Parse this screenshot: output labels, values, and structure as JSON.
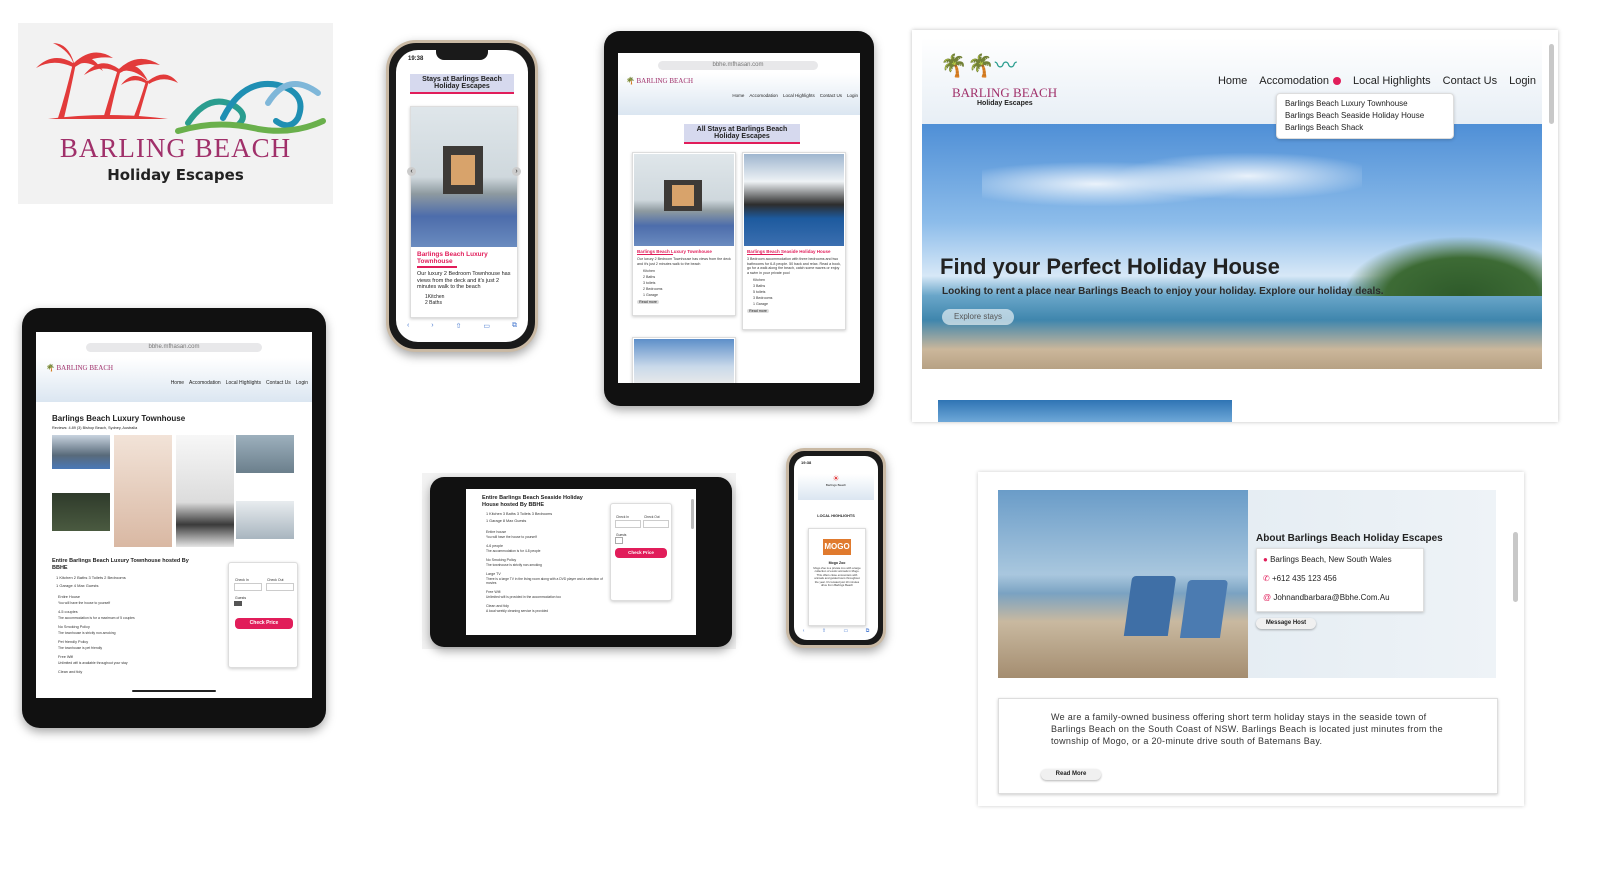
{
  "logo": {
    "brand": "BARLING BEACH",
    "tagline": "Holiday Escapes"
  },
  "colors": {
    "accent_pink": "#e11d5a",
    "palm_red": "#e23b3b",
    "wave_teal": "#2a9d8f",
    "logo_purple": "#a0306a"
  },
  "phone_top": {
    "time": "19:38",
    "heading": "Stays at Barlings Beach Holiday Escapes",
    "card_title": "Barlings Beach Luxury Townhouse",
    "card_text": "Our luxury 2 Bedroom Townhouse has views from the deck and it's just 2 minutes walk to the beach",
    "amenities": [
      "1Kitchen",
      "2 Baths"
    ]
  },
  "tablet_stays": {
    "url": "bbhe.mfhasan.com",
    "nav": [
      "Home",
      "Accomodation",
      "Local Highlights",
      "Contact Us",
      "Login"
    ],
    "heading": "All Stays at Barlings Beach Holiday Escapes",
    "cards": [
      {
        "title": "Barlings Beach Luxury Townhouse",
        "text": "Our luxury 2 Bedroom Townhouse has views from the deck and it's just 2 minutes walk to the beach",
        "amenities": [
          "Kitchen",
          "2 Baths",
          "3 toilets",
          "2 Bedrooms",
          "1 Garage"
        ],
        "button": "Read more"
      },
      {
        "title": "Barlings Beach Seaside Holiday House",
        "text": "3 Bedroom accommodation with three bedrooms and two bathrooms for 6-8 people. 50 back and relax. Read a book, go for a walk along the beach, catch some waves or enjoy a swim in your private pool",
        "amenities": [
          "Kitchen",
          "3 Baths",
          "5 toilets",
          "3 Bedrooms",
          "1 Garage"
        ],
        "button": "Read more"
      }
    ]
  },
  "desktop_home": {
    "logo_brand": "BARLING BEACH",
    "logo_tagline": "Holiday Escapes",
    "nav": {
      "home": "Home",
      "accommodation": "Accomodation",
      "local": "Local Highlights",
      "contact": "Contact Us",
      "login": "Login"
    },
    "dropdown": [
      "Barlings Beach Luxury Townhouse",
      "Barlings Beach Seaside Holiday House",
      "Barlings Beach Shack"
    ],
    "hero_title": "Find your Perfect Holiday House",
    "hero_subtitle": "Looking to rent a place near Barlings Beach to enjoy your holiday. Explore our holiday deals.",
    "hero_button": "Explore stays"
  },
  "tablet_detail": {
    "url": "bbhe.mfhasan.com",
    "nav": [
      "Home",
      "Accomodation",
      "Local Highlights",
      "Contact Us",
      "Login"
    ],
    "title": "Barlings Beach Luxury Townhouse",
    "reviews": "Reviews: 4.89 (3) Bishop Beach, Sydney, Australia",
    "subtitle": "Entire Barlings Beach Luxury Townhouse hosted By BBHE",
    "amenities_line": "1 Kitchen  2 Baths  3 Toilets  2 Bedrooms",
    "amenities_line2": "1 Garage  4 Max Guests",
    "features": [
      {
        "title": "Entire House",
        "text": "You will have the house to yourself"
      },
      {
        "title": "4-5 couples",
        "text": "The accommodation is for a maximum of 5 couples"
      },
      {
        "title": "No Smoking Policy",
        "text": "The townhouse is strictly non-smoking"
      },
      {
        "title": "Pet friendly Policy",
        "text": "The townhouse is pet friendly"
      },
      {
        "title": "Free Wifi",
        "text": "Unlimited wifi is available throughout your stay"
      },
      {
        "title": "Clean and tidy",
        "text": ""
      }
    ],
    "checkin": "Check In",
    "checkout": "Check Out",
    "guests": "Guests",
    "button": "Check Price"
  },
  "tablet_landscape": {
    "title": "Entire Barlings Beach Seaside Holiday House hosted By BBHE",
    "amenities_line": "1 Kitchen  3 Baths  3 Toilets  3 Bedrooms",
    "amenities_line2": "1 Garage  8 Max Guests",
    "features": [
      {
        "title": "Entire house",
        "text": "You will have the house to yourself"
      },
      {
        "title": "4-6 people",
        "text": "The accommodation is for 4-8 people"
      },
      {
        "title": "No Smoking Policy",
        "text": "The townhouse is strictly non-smoking"
      },
      {
        "title": "Large TV",
        "text": "There is a large TV in the living room along with a DVD player and a selection of movies"
      },
      {
        "title": "Free Wifi",
        "text": "Unlimited wifi is provided in the accommodation too"
      },
      {
        "title": "Clean and tidy",
        "text": "A local weekly cleaning service is provided"
      }
    ],
    "checkin": "Check In",
    "checkout": "Check Out",
    "guests": "Guests",
    "button": "Check Price"
  },
  "phone_small": {
    "time": "19:38",
    "brand": "Barlings Beach",
    "heading": "LOCAL HIGHLIGHTS",
    "card_logo": "MOGO",
    "card_title": "Mogo Zoo",
    "card_text": "Mogo Zoo is a private zoo with a large collection of exotic animals in Mogo. This offers close encounters with animals and guided tours throughout the year. It's located just 10 minutes drive from Barlings Beach"
  },
  "desktop_about": {
    "title": "About Barlings Beach Holiday Escapes",
    "location": "Barlings Beach, New South Wales",
    "phone": "+612 435 123 456",
    "email": "Johnandbarbara@Bbhe.Com.Au",
    "message_button": "Message Host",
    "description": "We are a family-owned business offering short term holiday stays in the seaside town of Barlings Beach on the South Coast of NSW. Barlings Beach is located just minutes from the township of Mogo, or a 20-minute drive south of Batemans Bay.",
    "read_more": "Read More"
  }
}
